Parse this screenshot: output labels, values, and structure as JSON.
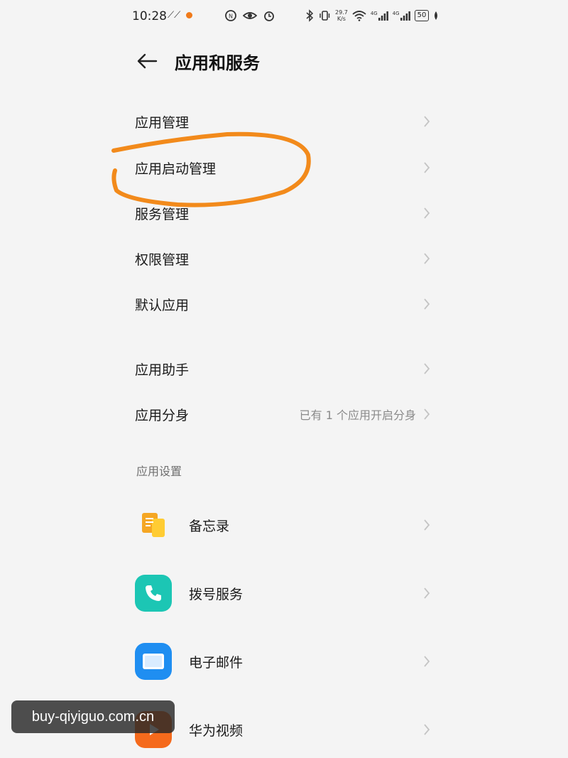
{
  "status_bar": {
    "time": "10:28",
    "net_speed_value": "29.7",
    "net_speed_unit": "K/s",
    "signal1_label": "4G",
    "signal2_label": "4G",
    "battery": "50"
  },
  "header": {
    "title": "应用和服务"
  },
  "menu": {
    "items": [
      {
        "label": "应用管理"
      },
      {
        "label": "应用启动管理"
      },
      {
        "label": "服务管理"
      },
      {
        "label": "权限管理"
      },
      {
        "label": "默认应用"
      },
      {
        "label": "应用助手"
      },
      {
        "label": "应用分身",
        "extra": "已有 1 个应用开启分身"
      }
    ]
  },
  "app_settings": {
    "section_title": "应用设置",
    "apps": [
      {
        "label": "备忘录",
        "icon": "memo-icon",
        "color": "#f5a623"
      },
      {
        "label": "拨号服务",
        "icon": "phone-icon",
        "color": "#1cc6b4"
      },
      {
        "label": "电子邮件",
        "icon": "mail-icon",
        "color": "#1f8ef1"
      },
      {
        "label": "华为视频",
        "icon": "video-icon",
        "color": "#f56a1c"
      }
    ]
  },
  "annotation": {
    "color": "#f28a1b"
  },
  "watermark": {
    "text": "buy-qiyiguo.com.cn"
  }
}
